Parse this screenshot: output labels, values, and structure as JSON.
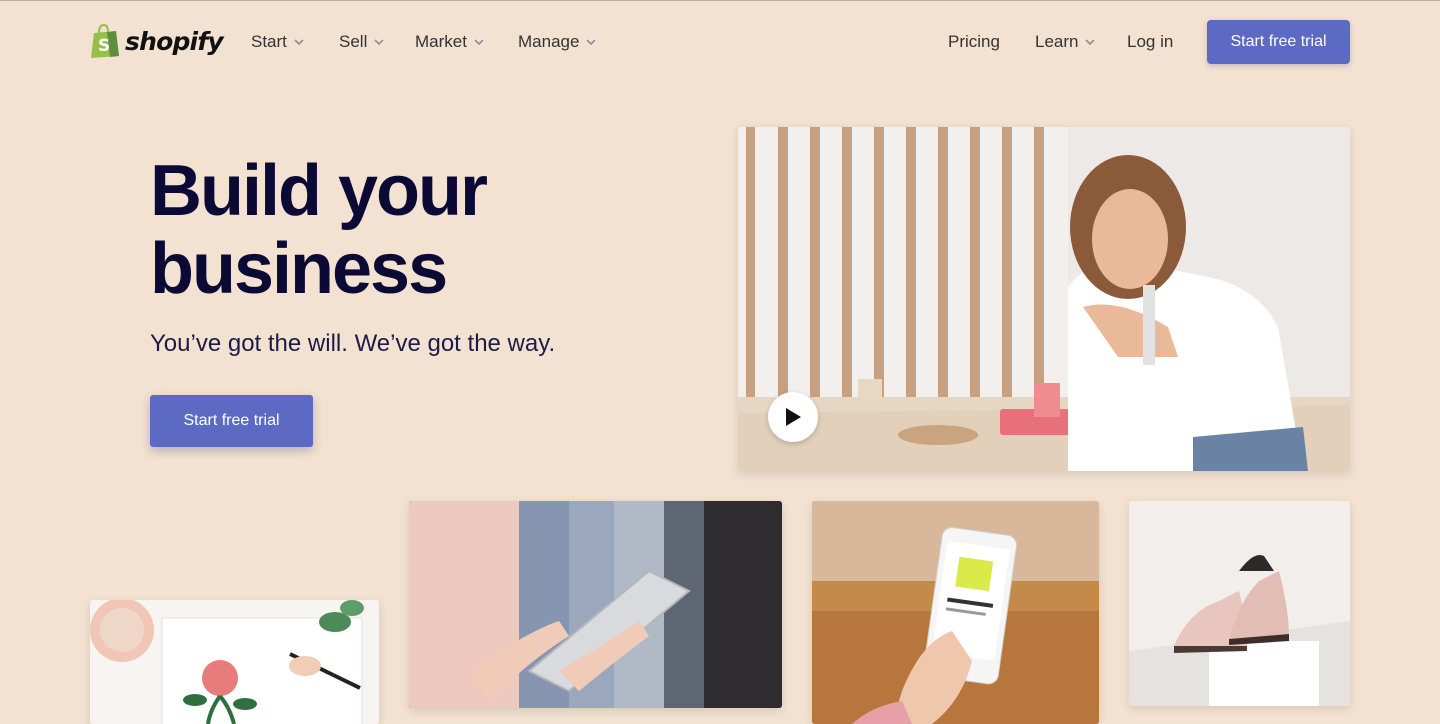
{
  "brand": {
    "name": "shopify",
    "logo_color": "#95bf47",
    "logo_letter": "S"
  },
  "nav": {
    "items": [
      {
        "label": "Start",
        "has_dropdown": true
      },
      {
        "label": "Sell",
        "has_dropdown": true
      },
      {
        "label": "Market",
        "has_dropdown": true
      },
      {
        "label": "Manage",
        "has_dropdown": true
      }
    ],
    "right": {
      "pricing": "Pricing",
      "learn": "Learn",
      "login": "Log in",
      "cta": "Start free trial"
    }
  },
  "hero": {
    "title_line1": "Build your",
    "title_line2": "business",
    "subtitle": "You’ve got the will. We’ve got the way.",
    "cta": "Start free trial"
  },
  "colors": {
    "background": "#f3e2d1",
    "accent": "#5c6ac4",
    "heading": "#0a0a35"
  },
  "media": {
    "video": {
      "has_play_button": true,
      "play_icon": "play-icon"
    }
  }
}
